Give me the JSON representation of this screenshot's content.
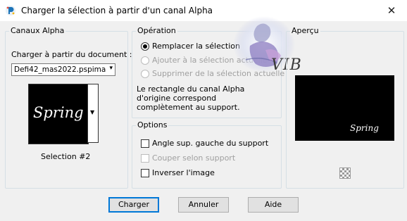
{
  "window": {
    "title": "Charger la sélection à partir d'un canal Alpha",
    "close_glyph": "✕"
  },
  "alpha": {
    "legend": "Canaux Alpha",
    "load_from_label": "Charger à partir du document :",
    "document_value": "Defi42_mas2022.pspimage",
    "thumbnail_text": "Spring",
    "selection_name": "Selection #2"
  },
  "operation": {
    "legend": "Opération",
    "options": [
      {
        "label": "Remplacer la sélection",
        "selected": true,
        "enabled": true
      },
      {
        "label": "Ajouter à la sélection actuelle",
        "selected": false,
        "enabled": false
      },
      {
        "label": "Supprimer de la sélection actuelle",
        "selected": false,
        "enabled": false
      }
    ],
    "info_lines": [
      "Le rectangle du canal Alpha",
      "d'origine correspond",
      "complètement au support."
    ]
  },
  "options": {
    "legend": "Options",
    "items": [
      {
        "label": "Angle sup. gauche du support",
        "checked": false,
        "enabled": true
      },
      {
        "label": "Couper selon support",
        "checked": false,
        "enabled": false
      },
      {
        "label": "Inverser l'image",
        "checked": false,
        "enabled": true
      }
    ]
  },
  "preview": {
    "legend": "Aperçu",
    "preview_text": "Spring"
  },
  "watermark": {
    "text": "VIB"
  },
  "buttons": {
    "ok": "Charger",
    "cancel": "Annuler",
    "help": "Aide"
  },
  "colors": {
    "focus": "#0078d7",
    "disabled_text": "#a0a0a0"
  }
}
